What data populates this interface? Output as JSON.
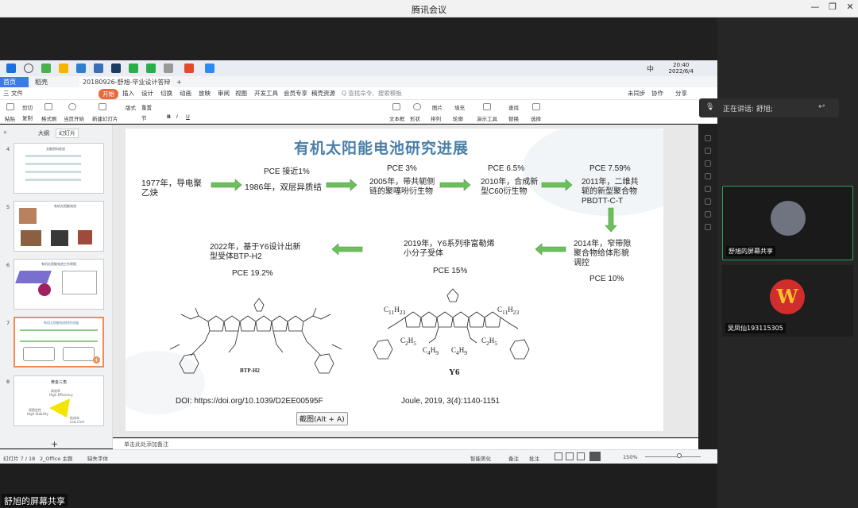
{
  "window": {
    "title": "腾讯会议"
  },
  "taskbar": {
    "tray_lang": "中",
    "time": "20:40",
    "date": "2022/6/4"
  },
  "wps": {
    "tabs": [
      {
        "label": "首页"
      },
      {
        "label": "稻壳"
      },
      {
        "label": "20180926-舒旭-毕业设计答辩"
      }
    ],
    "menu": [
      "三 文件",
      "开始",
      "插入",
      "设计",
      "切换",
      "动画",
      "放映",
      "审阅",
      "视图",
      "开发工具",
      "会员专享",
      "稿壳资源",
      "Q 查找命令、搜索模板"
    ],
    "menu_right": [
      "未同步",
      "协作",
      "分享"
    ],
    "ribbon": [
      "粘贴",
      "剪切",
      "复制",
      "格式刷",
      "当页开始",
      "新建幻灯片",
      "版式",
      "节",
      "重置",
      "文本框",
      "形状",
      "排列",
      "轮廓",
      "图片",
      "填充",
      "演示工具",
      "替换",
      "查找",
      "选择"
    ]
  },
  "panel": {
    "tab_outline": "大纲",
    "tab_slides": "幻灯片",
    "add": "+"
  },
  "thumbs": [
    {
      "num": "4",
      "title": "文献资料综述"
    },
    {
      "num": "5",
      "title": "有机太阳能电池"
    },
    {
      "num": "6",
      "title": "有机太阳能电池工作原理"
    },
    {
      "num": "7",
      "title": "有机太阳能电池研究进展"
    },
    {
      "num": "8",
      "title": "黄金三角",
      "l1": "高效率",
      "l2": "High Efficiency",
      "l3": "高稳定性",
      "l4": "High Stability",
      "l5": "低成本",
      "l6": "Low Cost"
    }
  ],
  "slide": {
    "title": "有机太阳能电池研究进展",
    "row1": [
      {
        "pce": "",
        "text": "1977年，导电聚乙炔"
      },
      {
        "pce": "PCE 接近1%",
        "text": "1986年，双层异质结"
      },
      {
        "pce": "PCE 3%",
        "text": "2005年，带共轭侧链的聚噻吩衍生物"
      },
      {
        "pce": "PCE 6.5%",
        "text": "2010年，合成新型C60衍生物"
      },
      {
        "pce": "PCE 7.59%",
        "text": "2011年，二维共轭的新型聚合物PBDTT-C-T"
      }
    ],
    "row2": [
      {
        "pce": "PCE 10%",
        "text": "2014年，窄带隙聚合物给体形貌调控"
      },
      {
        "pce": "PCE 15%",
        "text": "2019年，Y6系列非富勒烯小分子受体"
      },
      {
        "pce": "PCE 19.2%",
        "text": "2022年，基于Y6设计出新型受体BTP-H2"
      }
    ],
    "mol_left": "BTP-H2",
    "mol_right": "Y6",
    "doi": "DOI: https://doi.org/10.1039/D2EE00595F",
    "joule": "Joule, 2019, 3(4):1140-1151"
  },
  "hint": "截图(Alt + A)",
  "notes": "单击此处添加备注",
  "status": {
    "slide": "幻灯片 7 / 18",
    "theme": "2_Office 主题",
    "font": "缺失字体",
    "smart": "智能美化",
    "notes": "备注",
    "comments": "批注",
    "zoom": "150%"
  },
  "meeting": {
    "speaking": "正在讲话: 舒旭;",
    "tiles": [
      {
        "name": "舒旭的屏幕共享"
      },
      {
        "name": "吴凤仙193115305"
      }
    ],
    "share_label": "舒旭的屏幕共享"
  },
  "colors": {
    "arrow": "#5cb85c",
    "title": "#4a7fa8",
    "accent": "#e86a3a"
  }
}
